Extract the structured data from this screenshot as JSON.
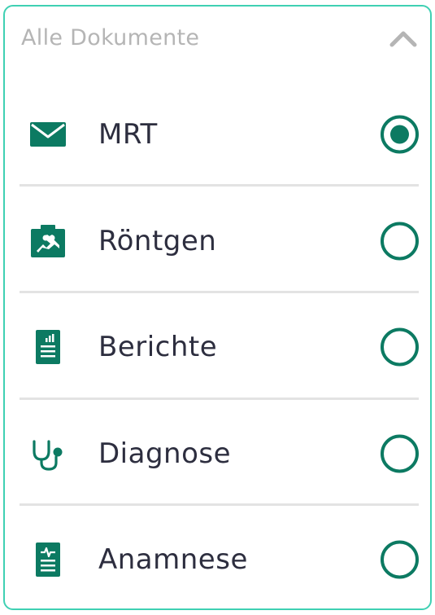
{
  "dropdown": {
    "title": "Alle Dokumente",
    "expanded": true,
    "chevron_icon": "chevron-up-icon",
    "selected_index": 0,
    "accent_color": "#0c7a62",
    "border_color": "#3fd0b3",
    "options": [
      {
        "label": "MRT",
        "icon": "envelope-icon",
        "selected": true
      },
      {
        "label": "Röntgen",
        "icon": "xray-image-icon",
        "selected": false
      },
      {
        "label": "Berichte",
        "icon": "report-document-icon",
        "selected": false
      },
      {
        "label": "Diagnose",
        "icon": "stethoscope-icon",
        "selected": false
      },
      {
        "label": "Anamnese",
        "icon": "medical-history-icon",
        "selected": false
      }
    ]
  }
}
